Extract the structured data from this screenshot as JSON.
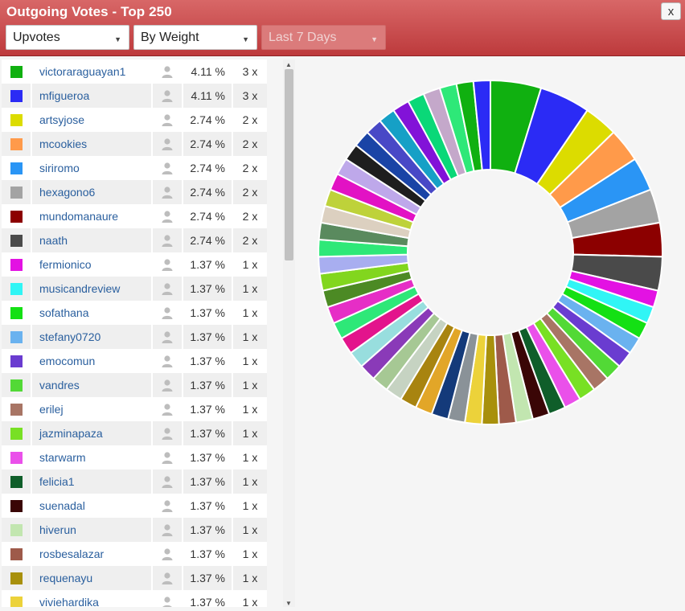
{
  "window": {
    "title": "Outgoing Votes - Top 250",
    "close_label": "x"
  },
  "filters": {
    "type_value": "Upvotes",
    "sort_value": "By Weight",
    "range_value": "Last 7 Days"
  },
  "voters": [
    {
      "name": "victoraraguayan1",
      "pct": "4.11 %",
      "count": "3 x",
      "color": "#10b010"
    },
    {
      "name": "mfigueroa",
      "pct": "4.11 %",
      "count": "3 x",
      "color": "#2b2bf5"
    },
    {
      "name": "artsyjose",
      "pct": "2.74 %",
      "count": "2 x",
      "color": "#dcdc00"
    },
    {
      "name": "mcookies",
      "pct": "2.74 %",
      "count": "2 x",
      "color": "#ff9a4a"
    },
    {
      "name": "siriromo",
      "pct": "2.74 %",
      "count": "2 x",
      "color": "#2a95f5"
    },
    {
      "name": "hexagono6",
      "pct": "2.74 %",
      "count": "2 x",
      "color": "#a3a3a3"
    },
    {
      "name": "mundomanaure",
      "pct": "2.74 %",
      "count": "2 x",
      "color": "#8c0000"
    },
    {
      "name": "naath",
      "pct": "2.74 %",
      "count": "2 x",
      "color": "#4a4a4a"
    },
    {
      "name": "fermionico",
      "pct": "1.37 %",
      "count": "1 x",
      "color": "#e312e3"
    },
    {
      "name": "musicandreview",
      "pct": "1.37 %",
      "count": "1 x",
      "color": "#30f5f5"
    },
    {
      "name": "sofathana",
      "pct": "1.37 %",
      "count": "1 x",
      "color": "#14e014"
    },
    {
      "name": "stefany0720",
      "pct": "1.37 %",
      "count": "1 x",
      "color": "#6ab2ef"
    },
    {
      "name": "emocomun",
      "pct": "1.37 %",
      "count": "1 x",
      "color": "#6a3cd0"
    },
    {
      "name": "vandres",
      "pct": "1.37 %",
      "count": "1 x",
      "color": "#52d936"
    },
    {
      "name": "erilej",
      "pct": "1.37 %",
      "count": "1 x",
      "color": "#a87565"
    },
    {
      "name": "jazminapaza",
      "pct": "1.37 %",
      "count": "1 x",
      "color": "#78e024"
    },
    {
      "name": "starwarm",
      "pct": "1.37 %",
      "count": "1 x",
      "color": "#ea50ea"
    },
    {
      "name": "felicia1",
      "pct": "1.37 %",
      "count": "1 x",
      "color": "#0f5e2a"
    },
    {
      "name": "suenadal",
      "pct": "1.37 %",
      "count": "1 x",
      "color": "#3a0606"
    },
    {
      "name": "hiverun",
      "pct": "1.37 %",
      "count": "1 x",
      "color": "#c2e6b0"
    },
    {
      "name": "rosbesalazar",
      "pct": "1.37 %",
      "count": "1 x",
      "color": "#9e5a4a"
    },
    {
      "name": "requenayu",
      "pct": "1.37 %",
      "count": "1 x",
      "color": "#a8900c"
    },
    {
      "name": "viviehardika",
      "pct": "1.37 %",
      "count": "1 x",
      "color": "#ecd23a"
    }
  ],
  "chart_data": {
    "type": "pie",
    "variant": "donut",
    "slice_values": [
      4.11,
      4.11,
      2.74,
      2.74,
      2.74,
      2.74,
      2.74,
      2.74,
      1.37,
      1.37,
      1.37,
      1.37,
      1.37,
      1.37,
      1.37,
      1.37,
      1.37,
      1.37,
      1.37,
      1.37,
      1.37,
      1.37,
      1.37,
      1.37,
      1.37,
      1.37,
      1.37,
      1.37,
      1.37,
      1.37,
      1.37,
      1.37,
      1.37,
      1.37,
      1.37,
      1.37,
      1.37,
      1.37,
      1.37,
      1.37,
      1.37,
      1.37,
      1.37,
      1.37,
      1.37,
      1.37,
      1.37,
      1.37,
      1.37,
      1.37,
      1.37,
      1.37,
      1.37
    ],
    "slice_colors": [
      "#10b010",
      "#2b2bf5",
      "#dcdc00",
      "#ff9a4a",
      "#2a95f5",
      "#a3a3a3",
      "#8c0000",
      "#4a4a4a",
      "#e312e3",
      "#30f5f5",
      "#14e014",
      "#6ab2ef",
      "#6a3cd0",
      "#52d936",
      "#a87565",
      "#78e024",
      "#ea50ea",
      "#0f5e2a",
      "#3a0606",
      "#c2e6b0",
      "#9e5a4a",
      "#a8900c",
      "#ecd23a",
      "#8a9298",
      "#143a7a",
      "#e2a628",
      "#a88410",
      "#c6d3c2",
      "#a6c894",
      "#8a3ab8",
      "#98dede",
      "#e3148c",
      "#2ee878",
      "#e62ec6",
      "#4c8a24",
      "#82d61e",
      "#a8aef0",
      "#2ee878",
      "#5a8a5e",
      "#dcd0c0",
      "#bed23a",
      "#e212c4",
      "#bea8ea",
      "#1e1e1e",
      "#1a44a6",
      "#4848c6",
      "#16a0c6",
      "#8212d8",
      "#0ad878",
      "#c4a8ca",
      "#2ee878"
    ]
  }
}
